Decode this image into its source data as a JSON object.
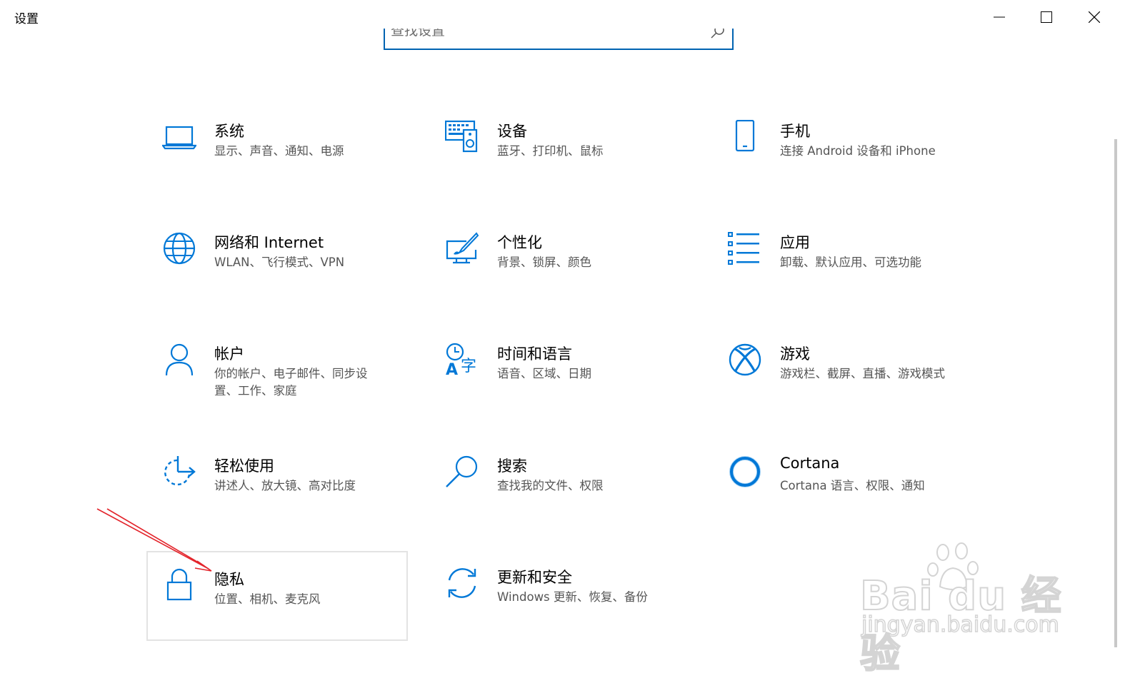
{
  "window": {
    "title": "设置",
    "controls": [
      "minimize-icon",
      "maximize-icon",
      "close-icon"
    ]
  },
  "search": {
    "placeholder": "查找设置",
    "icon": "search-icon"
  },
  "accent_color": "#0078D7",
  "tiles": [
    {
      "name": "系统",
      "desc": "显示、声音、通知、电源",
      "icon": "laptop-icon"
    },
    {
      "name": "设备",
      "desc": "蓝牙、打印机、鼠标",
      "icon": "keyboard-speaker-icon"
    },
    {
      "name": "手机",
      "desc": "连接 Android 设备和 iPhone",
      "icon": "phone-icon"
    },
    {
      "name": "网络和 Internet",
      "desc": "WLAN、飞行模式、VPN",
      "icon": "globe-icon"
    },
    {
      "name": "个性化",
      "desc": "背景、锁屏、颜色",
      "icon": "paint-brush-icon"
    },
    {
      "name": "应用",
      "desc": "卸载、默认应用、可选功能",
      "icon": "app-list-icon"
    },
    {
      "name": "帐户",
      "desc": "你的帐户、电子邮件、同步设置、工作、家庭",
      "icon": "person-icon"
    },
    {
      "name": "时间和语言",
      "desc": "语音、区域、日期",
      "icon": "time-language-icon"
    },
    {
      "name": "游戏",
      "desc": "游戏栏、截屏、直播、游戏模式",
      "icon": "xbox-icon"
    },
    {
      "name": "轻松使用",
      "desc": "讲述人、放大镜、高对比度",
      "icon": "ease-of-access-icon"
    },
    {
      "name": "搜索",
      "desc": "查找我的文件、权限",
      "icon": "search-magnifier-icon"
    },
    {
      "name": "Cortana",
      "desc": "Cortana 语言、权限、通知",
      "icon": "cortana-ring-icon"
    },
    {
      "name": "隐私",
      "desc": "位置、相机、麦克风",
      "icon": "lock-icon"
    },
    {
      "name": "更新和安全",
      "desc": "Windows 更新、恢复、备份",
      "icon": "sync-icon"
    }
  ],
  "watermark": {
    "brand": "Bai du 经验",
    "url": "jingyan.baidu.com"
  }
}
